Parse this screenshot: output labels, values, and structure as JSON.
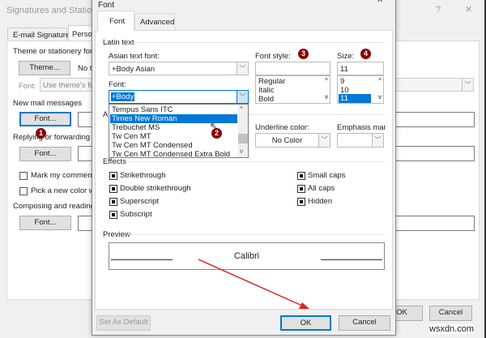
{
  "background_dialog": {
    "title": "Signatures and Stationery",
    "help": "?",
    "close": "✕",
    "tabs": [
      "E-mail Signature",
      "Personal Stationery"
    ],
    "theme_label": "Theme or stationery for new HTML e-mail message",
    "theme_button": "Theme...",
    "theme_value": "No t",
    "font_label": "Font:",
    "font_value": "Use theme's font",
    "new_mail": "New mail messages",
    "font_button": "Font...",
    "replying": "Replying or forwarding messages",
    "mark_comments": "Mark my comments",
    "pick_color": "Pick a new color whe",
    "composing": "Composing and reading plain text messages",
    "ok": "OK",
    "cancel": "Cancel"
  },
  "font_dialog": {
    "title": "Font",
    "close": "✕",
    "tabs": [
      "Font",
      "Advanced"
    ],
    "latin_text": "Latin text",
    "asian_font_label": "Asian text font:",
    "asian_font_value": "+Body Asian",
    "font_label": "Font:",
    "font_value": "+Body",
    "font_list": [
      "Tempus Sans ITC",
      "Times New Roman",
      "Trebuchet MS",
      "Tw Cen MT",
      "Tw Cen MT Condensed",
      "Tw Cen MT Condensed Extra Bold"
    ],
    "all_text_label": "Al",
    "style_label": "Font style:",
    "style_value": "",
    "style_list": [
      "Regular",
      "Italic",
      "Bold"
    ],
    "size_label": "Size:",
    "size_value": "11",
    "size_list": [
      "9",
      "10",
      "11"
    ],
    "underline_color_label": "Underline color:",
    "underline_color_value": "No Color",
    "emphasis_label": "Emphasis mark:",
    "effects_label": "Effects",
    "effects_left": [
      "Strikethrough",
      "Double strikethrough",
      "Superscript",
      "Subscript"
    ],
    "effects_right": [
      "Small caps",
      "All caps",
      "Hidden"
    ],
    "preview_label": "Preview",
    "preview_text": "Calibri",
    "set_default": "Set As Default",
    "ok": "OK",
    "cancel": "Cancel"
  },
  "badges": [
    "1",
    "2",
    "3",
    "4"
  ],
  "watermark": "wsxdn.com",
  "colors": {
    "selection": "#0078d7",
    "badge": "#8b0000",
    "arrow": "#e02020"
  }
}
